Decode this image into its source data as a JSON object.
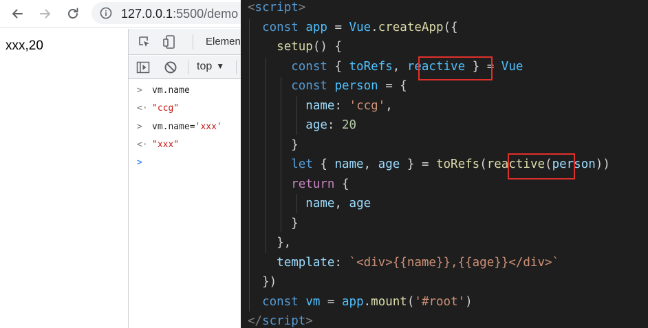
{
  "browser": {
    "url_host": "127.0.0.1",
    "url_rest": ":5500/demo",
    "icons": [
      "back-arrow-icon",
      "forward-arrow-icon",
      "reload-icon",
      "info-icon"
    ]
  },
  "page": {
    "output_text": "xxx,20"
  },
  "devtools": {
    "tabs": {
      "elements_label": "Elemen"
    },
    "toolbar": {
      "context_select": "top"
    },
    "console": [
      {
        "kind": "input",
        "text": "vm.name"
      },
      {
        "kind": "output",
        "text": "\"ccg\""
      },
      {
        "kind": "input",
        "text": "vm.name='xxx'"
      },
      {
        "kind": "output",
        "text": "\"xxx\""
      }
    ],
    "colors": {
      "string": "#c41a16",
      "prompt": "#1a73e8"
    }
  },
  "editor": {
    "theme": {
      "background": "#1e1e1e",
      "highlight_box": "#e0302b"
    },
    "lines": [
      [
        [
          "tag",
          "<"
        ],
        [
          "name",
          "script"
        ],
        [
          "tag",
          ">"
        ]
      ],
      [
        [
          "punc",
          "  "
        ],
        [
          "kw",
          "const"
        ],
        [
          "punc",
          " "
        ],
        [
          "const",
          "app"
        ],
        [
          "punc",
          " = "
        ],
        [
          "const",
          "Vue"
        ],
        [
          "punc",
          "."
        ],
        [
          "fn",
          "createApp"
        ],
        [
          "punc",
          "({"
        ]
      ],
      [
        [
          "punc",
          "    "
        ],
        [
          "fn",
          "setup"
        ],
        [
          "punc",
          "() {"
        ]
      ],
      [
        [
          "punc",
          "      "
        ],
        [
          "kw",
          "const"
        ],
        [
          "punc",
          " { "
        ],
        [
          "const",
          "toRefs"
        ],
        [
          "punc",
          ", "
        ],
        [
          "const",
          "reactive"
        ],
        [
          "punc",
          " } = "
        ],
        [
          "const",
          "Vue"
        ]
      ],
      [
        [
          "punc",
          "      "
        ],
        [
          "kw",
          "const"
        ],
        [
          "punc",
          " "
        ],
        [
          "const",
          "person"
        ],
        [
          "punc",
          " = {"
        ]
      ],
      [
        [
          "punc",
          "        "
        ],
        [
          "var",
          "name"
        ],
        [
          "punc",
          ": "
        ],
        [
          "str",
          "'ccg'"
        ],
        [
          "punc",
          ","
        ]
      ],
      [
        [
          "punc",
          "        "
        ],
        [
          "var",
          "age"
        ],
        [
          "punc",
          ": "
        ],
        [
          "num",
          "20"
        ]
      ],
      [
        [
          "punc",
          "      }"
        ]
      ],
      [
        [
          "punc",
          "      "
        ],
        [
          "kw",
          "let"
        ],
        [
          "punc",
          " { "
        ],
        [
          "var",
          "name"
        ],
        [
          "punc",
          ", "
        ],
        [
          "var",
          "age"
        ],
        [
          "punc",
          " } = "
        ],
        [
          "fn",
          "toRefs"
        ],
        [
          "punc",
          "("
        ],
        [
          "fn",
          "reactive"
        ],
        [
          "punc",
          "("
        ],
        [
          "var",
          "person"
        ],
        [
          "punc",
          "))"
        ]
      ],
      [
        [
          "punc",
          "      "
        ],
        [
          "ctrl",
          "return"
        ],
        [
          "punc",
          " {"
        ]
      ],
      [
        [
          "punc",
          "        "
        ],
        [
          "var",
          "name"
        ],
        [
          "punc",
          ", "
        ],
        [
          "var",
          "age"
        ]
      ],
      [
        [
          "punc",
          "      }"
        ]
      ],
      [
        [
          "punc",
          "    },"
        ]
      ],
      [
        [
          "punc",
          "    "
        ],
        [
          "var",
          "template"
        ],
        [
          "punc",
          ": "
        ],
        [
          "str",
          "`<div>{{name}},{{age}}</div>`"
        ]
      ],
      [
        [
          "punc",
          "  })"
        ]
      ],
      [
        [
          "punc",
          "  "
        ],
        [
          "kw",
          "const"
        ],
        [
          "punc",
          " "
        ],
        [
          "const",
          "vm"
        ],
        [
          "punc",
          " = "
        ],
        [
          "const",
          "app"
        ],
        [
          "punc",
          "."
        ],
        [
          "fn",
          "mount"
        ],
        [
          "punc",
          "("
        ],
        [
          "str",
          "'#root'"
        ],
        [
          "punc",
          ")"
        ]
      ],
      [
        [
          "tag",
          "</"
        ],
        [
          "name",
          "script"
        ],
        [
          "tag",
          ">"
        ]
      ]
    ]
  }
}
